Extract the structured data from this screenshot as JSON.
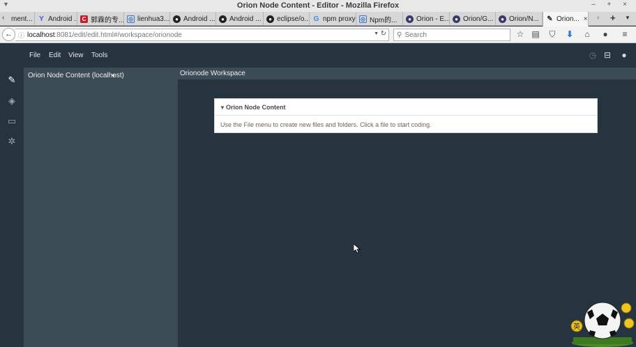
{
  "window": {
    "title": "Orion Node Content - Editor - Mozilla Firefox",
    "menu_glyph": "▼",
    "controls": "– + ×"
  },
  "tabs": [
    {
      "label": "ment...",
      "icon": "page-icon",
      "icon_color": "#ffffff"
    },
    {
      "label": "Android ...",
      "icon": "yahoo-filter-icon",
      "icon_color": "#3b5bdb"
    },
    {
      "label": "郭霖的专...",
      "icon": "csdn-icon",
      "icon_color": "#c81d25"
    },
    {
      "label": "lienhua3...",
      "icon": "blog-icon",
      "icon_color": "#3a78c9"
    },
    {
      "label": "Android ...",
      "icon": "github-icon",
      "icon_color": "#222222"
    },
    {
      "label": "Android ...",
      "icon": "github-icon",
      "icon_color": "#222222"
    },
    {
      "label": "eclipse/o...",
      "icon": "github-icon",
      "icon_color": "#222222"
    },
    {
      "label": "npm proxy",
      "icon": "google-icon",
      "icon_color": "#4285f4"
    },
    {
      "label": "Npm的...",
      "icon": "blog-icon",
      "icon_color": "#3a78c9"
    },
    {
      "label": "Orion - E...",
      "icon": "orion-icon",
      "icon_color": "#3a3a6a"
    },
    {
      "label": "Orion/G...",
      "icon": "orion-icon",
      "icon_color": "#3a3a6a"
    },
    {
      "label": "Orion/N...",
      "icon": "orion-icon",
      "icon_color": "#3a3a6a"
    },
    {
      "label": "Orion...",
      "icon": "pencil-icon",
      "icon_color": "#333333",
      "active": true
    }
  ],
  "tab_close": "×",
  "navbar": {
    "url_host": "localhost",
    "url_path": ":8081/edit/edit.html#/workspace/orionode",
    "search_placeholder": "Search"
  },
  "app": {
    "menu": [
      "File",
      "Edit",
      "View",
      "Tools"
    ],
    "nav_title": "Orion Node Content (localhost)",
    "workspace_title": "Orionode Workspace",
    "card_title": "Orion Node Content",
    "card_body": "Use the File menu to create new files and folders. Click a file to start coding."
  },
  "colors": {
    "app_background": "#26343f",
    "pane_background": "#3b4c56",
    "download_arrow": "#2f7fd1"
  }
}
